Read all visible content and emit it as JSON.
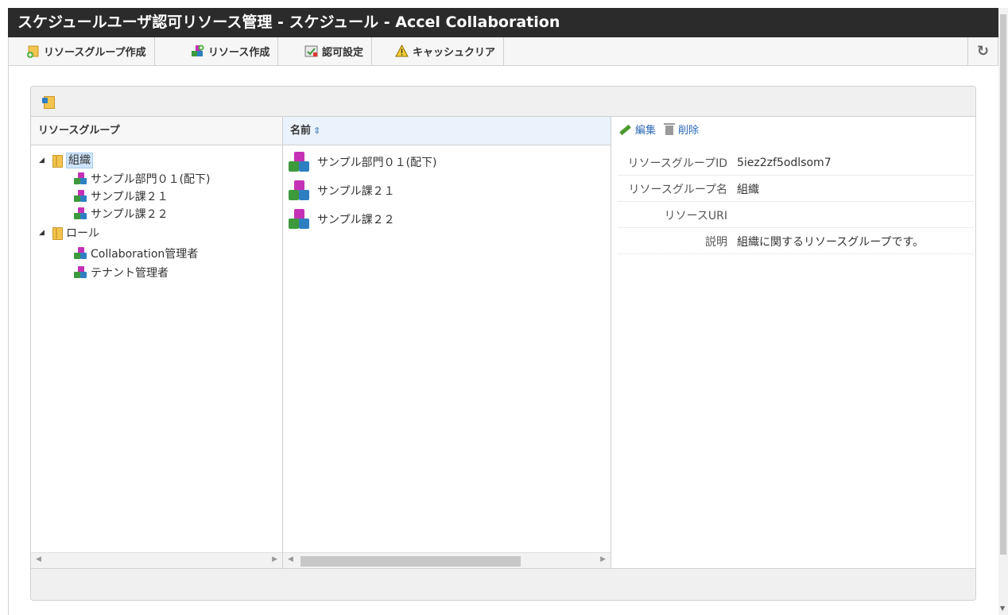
{
  "window": {
    "title": "スケジュールユーザ認可リソース管理 - スケジュール - Accel Collaboration"
  },
  "toolbar": {
    "create_group_label": "リソースグループ作成",
    "create_resource_label": "リソース作成",
    "auth_settings_label": "認可設定",
    "cache_clear_label": "キャッシュクリア",
    "refresh_icon": "↻"
  },
  "left_column": {
    "header": "リソースグループ",
    "tree": [
      {
        "label": "組織",
        "type": "group",
        "expanded": true,
        "selected": true
      },
      {
        "label": "サンプル部門０１(配下)",
        "type": "resource"
      },
      {
        "label": "サンプル課２１",
        "type": "resource"
      },
      {
        "label": "サンプル課２２",
        "type": "resource"
      },
      {
        "label": "ロール",
        "type": "group",
        "expanded": true
      },
      {
        "label": "Collaboration管理者",
        "type": "resource"
      },
      {
        "label": "テナント管理者",
        "type": "resource"
      }
    ]
  },
  "middle_column": {
    "header": "名前",
    "sort_icon": "⇕",
    "items": [
      {
        "label": "サンプル部門０１(配下)"
      },
      {
        "label": "サンプル課２１"
      },
      {
        "label": "サンプル課２２"
      }
    ]
  },
  "detail": {
    "edit_label": "編集",
    "delete_label": "削除",
    "rows": [
      {
        "key": "リソースグループID",
        "value": "5iez2zf5odlsom7"
      },
      {
        "key": "リソースグループ名",
        "value": "組織"
      },
      {
        "key": "リソースURI",
        "value": ""
      },
      {
        "key": "説明",
        "value": "組織に関するリソースグループです。"
      }
    ]
  },
  "colors": {
    "accent": "#2a68b7",
    "titlebar": "#2b2b2b",
    "selection": "#cfe5fa"
  }
}
